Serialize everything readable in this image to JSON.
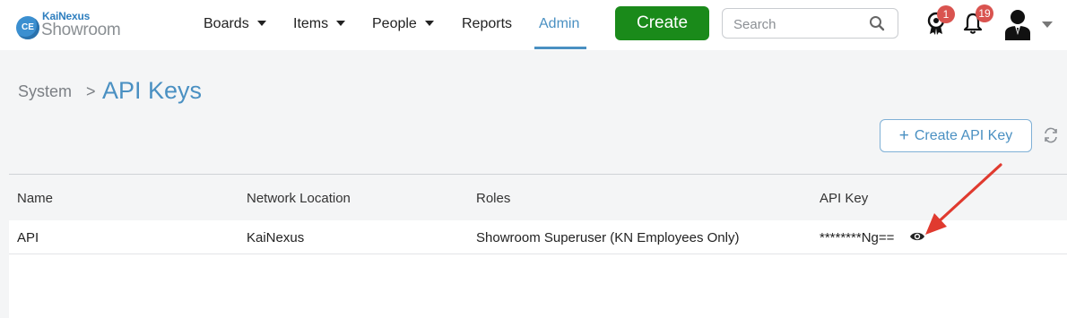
{
  "logo": {
    "badge": "CE",
    "brand": "KaiNexus",
    "product": "Showroom"
  },
  "nav": {
    "items": [
      {
        "label": "Boards",
        "has_dropdown": true
      },
      {
        "label": "Items",
        "has_dropdown": true
      },
      {
        "label": "People",
        "has_dropdown": true
      },
      {
        "label": "Reports",
        "has_dropdown": false
      },
      {
        "label": "Admin",
        "has_dropdown": false,
        "active": true
      }
    ],
    "create_label": "Create",
    "search_placeholder": "Search",
    "awards_count": "1",
    "notifications_count": "19"
  },
  "breadcrumb": {
    "parent": "System",
    "separator": ">",
    "current": "API Keys"
  },
  "actions": {
    "create_key_label": "Create API Key"
  },
  "table": {
    "columns": [
      "Name",
      "Network Location",
      "Roles",
      "API Key"
    ],
    "rows": [
      {
        "name": "API",
        "network_location": "KaiNexus",
        "roles": "Showroom Superuser (KN Employees Only)",
        "api_key": "********Ng=="
      }
    ]
  },
  "colors": {
    "accent": "#4a90c2",
    "create_button": "#1a8a1a",
    "badge": "#d9534f",
    "annotation_arrow": "#e03a2f"
  }
}
